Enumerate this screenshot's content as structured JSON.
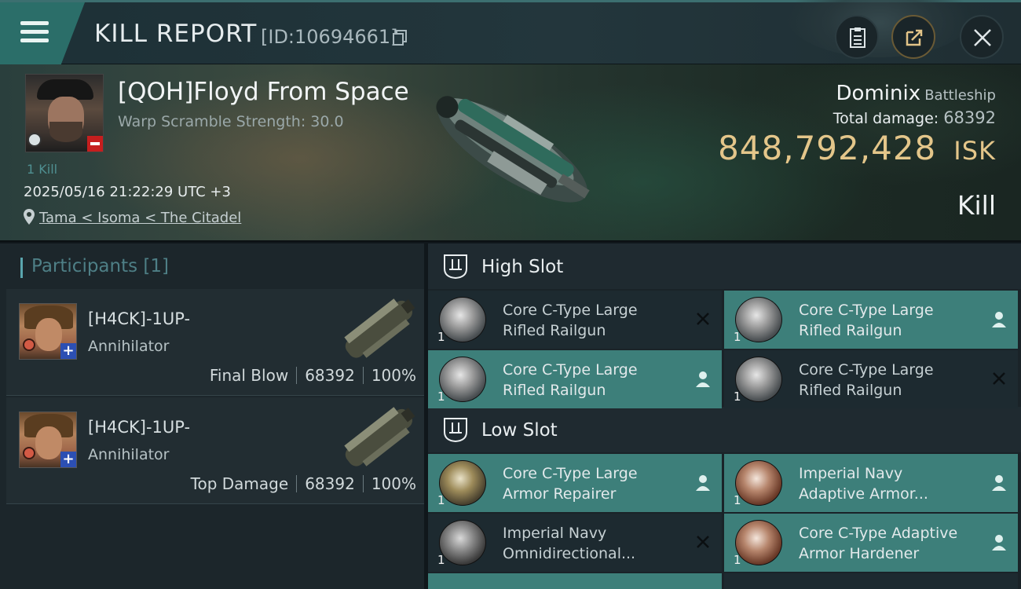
{
  "header": {
    "title": "KILL REPORT",
    "report_id": "[ID:10694661]"
  },
  "victim": {
    "name": "[QOH]Floyd From Space",
    "warp_scramble": "Warp Scramble Strength: 30.0",
    "kill_count": "1 Kill",
    "datetime": "2025/05/16 21:22:29 UTC +3",
    "location": "Tama < Isoma < The Citadel"
  },
  "ship": {
    "name": "Dominix",
    "class": "Battleship",
    "total_damage_label": "Total damage:",
    "total_damage": "68392",
    "isk_value": "848,792,428",
    "isk_unit": "ISK",
    "type": "Kill"
  },
  "participants": {
    "heading": "Participants [1]",
    "rows": [
      {
        "name": "[H4CK]-1UP-",
        "ship": "Annihilator",
        "role": "Final Blow",
        "damage": "68392",
        "percent": "100%"
      },
      {
        "name": "[H4CK]-1UP-",
        "ship": "Annihilator",
        "role": "Top Damage",
        "damage": "68392",
        "percent": "100%"
      }
    ]
  },
  "fitting": {
    "high_slot_label": "High Slot",
    "low_slot_label": "Low Slot",
    "high": [
      {
        "name": "Core C-Type Large\nRifled Railgun",
        "qty": "1",
        "status": "destroyed",
        "icon": "railgun-icon"
      },
      {
        "name": "Core C-Type Large\nRifled Railgun",
        "qty": "1",
        "status": "dropped",
        "icon": "railgun-icon"
      },
      {
        "name": "Core C-Type Large\nRifled Railgun",
        "qty": "1",
        "status": "dropped",
        "icon": "railgun-icon"
      },
      {
        "name": "Core C-Type Large\nRifled Railgun",
        "qty": "1",
        "status": "destroyed",
        "icon": "railgun-icon"
      }
    ],
    "low": [
      {
        "name": "Core C-Type Large\nArmor Repairer",
        "qty": "1",
        "status": "dropped",
        "icon": "armor-repairer-icon"
      },
      {
        "name": "Imperial Navy\nAdaptive Armor...",
        "qty": "1",
        "status": "dropped",
        "icon": "armor-hardener-icon"
      },
      {
        "name": "Imperial Navy\nOmnidirectional...",
        "qty": "1",
        "status": "destroyed",
        "icon": "damage-control-icon"
      },
      {
        "name": "Core C-Type Adaptive\n Armor Hardener",
        "qty": "1",
        "status": "dropped",
        "icon": "armor-hardener-icon"
      }
    ]
  },
  "colors": {
    "accent_teal": "#3d7f7a",
    "isk_gold": "#e4c68a",
    "loss_red": "#c61e1e",
    "header_teal": "#2b6e69"
  }
}
